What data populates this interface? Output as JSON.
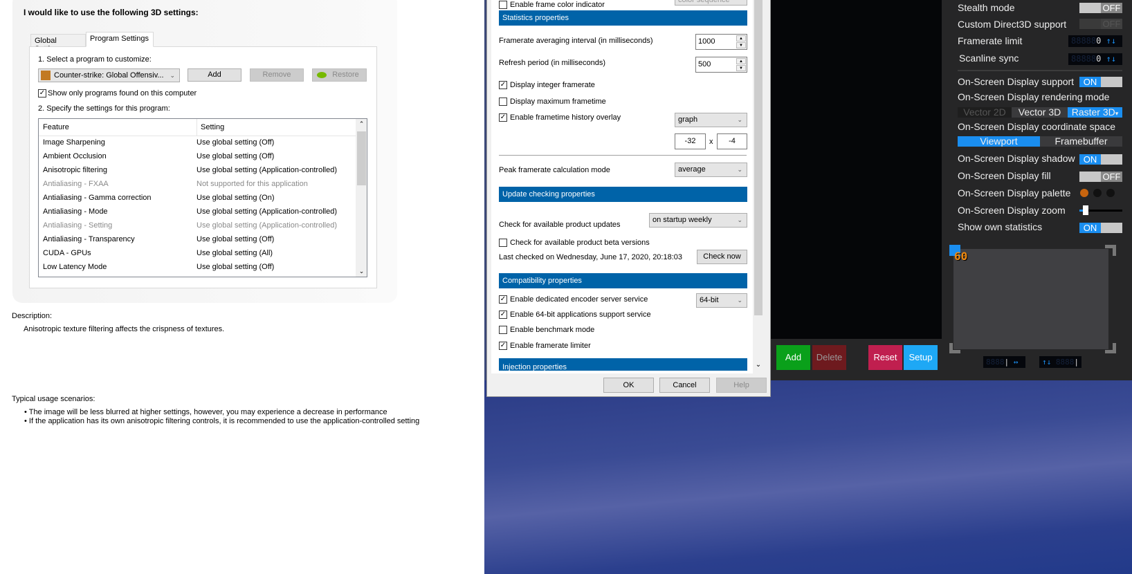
{
  "nvidia": {
    "title": "I would like to use the following 3D settings:",
    "tabs": [
      "Global Settings",
      "Program Settings"
    ],
    "select_label": "1. Select a program to customize:",
    "program": "Counter-strike: Global Offensiv...",
    "add": "Add",
    "remove": "Remove",
    "restore": "Restore",
    "show_only": "Show only programs found on this computer",
    "specify_label": "2. Specify the settings for this program:",
    "columns": [
      "Feature",
      "Setting"
    ],
    "rows": [
      {
        "feature": "Image Sharpening",
        "setting": "Use global setting (Off)"
      },
      {
        "feature": "Ambient Occlusion",
        "setting": "Use global setting (Off)"
      },
      {
        "feature": "Anisotropic filtering",
        "setting": "Use global setting (Application-controlled)"
      },
      {
        "feature": "Antialiasing - FXAA",
        "setting": "Not supported for this application"
      },
      {
        "feature": "Antialiasing - Gamma correction",
        "setting": "Use global setting (On)"
      },
      {
        "feature": "Antialiasing - Mode",
        "setting": "Use global setting (Application-controlled)"
      },
      {
        "feature": "Antialiasing - Setting",
        "setting": "Use global setting (Application-controlled)"
      },
      {
        "feature": "Antialiasing - Transparency",
        "setting": "Use global setting (Off)"
      },
      {
        "feature": "CUDA - GPUs",
        "setting": "Use global setting (All)"
      },
      {
        "feature": "Low Latency Mode",
        "setting": "Use global setting (Off)"
      }
    ],
    "description_label": "Description:",
    "description": "Anisotropic texture filtering affects the crispness of textures.",
    "usage_label": "Typical usage scenarios:",
    "usage": [
      "The image will be less blurred at higher settings, however, you may experience a decrease in performance",
      "If the application has its own anisotropic filtering controls, it is recommended to use the application-controlled setting"
    ]
  },
  "props": {
    "frame_color_label": "Enable frame color indicator",
    "frame_color_value": "color sequence",
    "stats_header": "Statistics properties",
    "avg_label": "Framerate averaging interval (in milliseconds)",
    "avg_value": "1000",
    "refresh_label": "Refresh period (in milliseconds)",
    "refresh_value": "500",
    "integer_label": "Display integer framerate",
    "maxft_label": "Display maximum frametime",
    "history_label": "Enable frametime history overlay",
    "history_value": "graph",
    "pos_x": "-32",
    "pos_sep": "x",
    "pos_y": "-4",
    "peak_label": "Peak framerate calculation mode",
    "peak_value": "average",
    "update_header": "Update checking properties",
    "updates_label": "Check for available product updates",
    "updates_value": "on startup weekly",
    "beta_label": "Check for available product beta versions",
    "last_checked": "Last checked on Wednesday, June 17, 2020, 20:18:03",
    "check_now": "Check now",
    "compat_header": "Compatibility properties",
    "encoder_label": "Enable dedicated encoder server service",
    "encoder_value": "64-bit",
    "x64_label": "Enable 64-bit applications support service",
    "bench_label": "Enable benchmark mode",
    "limiter_label": "Enable framerate limiter",
    "injection_header": "Injection properties",
    "ok": "OK",
    "cancel": "Cancel",
    "help": "Help"
  },
  "rtss": {
    "stealth": "Stealth mode",
    "custom_d3d": "Custom Direct3D support",
    "framerate_limit": "Framerate limit",
    "framerate_limit_value": "0",
    "scanline": "Scanline sync",
    "scanline_value": "0",
    "osd_support": "On-Screen Display support",
    "osd_render": "On-Screen Display rendering mode",
    "render_modes": [
      "Vector 2D",
      "Vector 3D",
      "Raster 3D"
    ],
    "osd_coord": "On-Screen Display coordinate space",
    "coord_modes": [
      "Viewport",
      "Framebuffer"
    ],
    "osd_shadow": "On-Screen Display shadow",
    "osd_fill": "On-Screen Display fill",
    "osd_palette": "On-Screen Display palette",
    "osd_zoom": "On-Screen Display zoom",
    "own_stats": "Show own statistics",
    "on": "ON",
    "off": "OFF",
    "preview_fps": "60",
    "add": "Add",
    "delete": "Delete",
    "reset": "Reset",
    "setup": "Setup",
    "palette_colors": [
      "#c8650f",
      "#111111",
      "#111111"
    ]
  }
}
